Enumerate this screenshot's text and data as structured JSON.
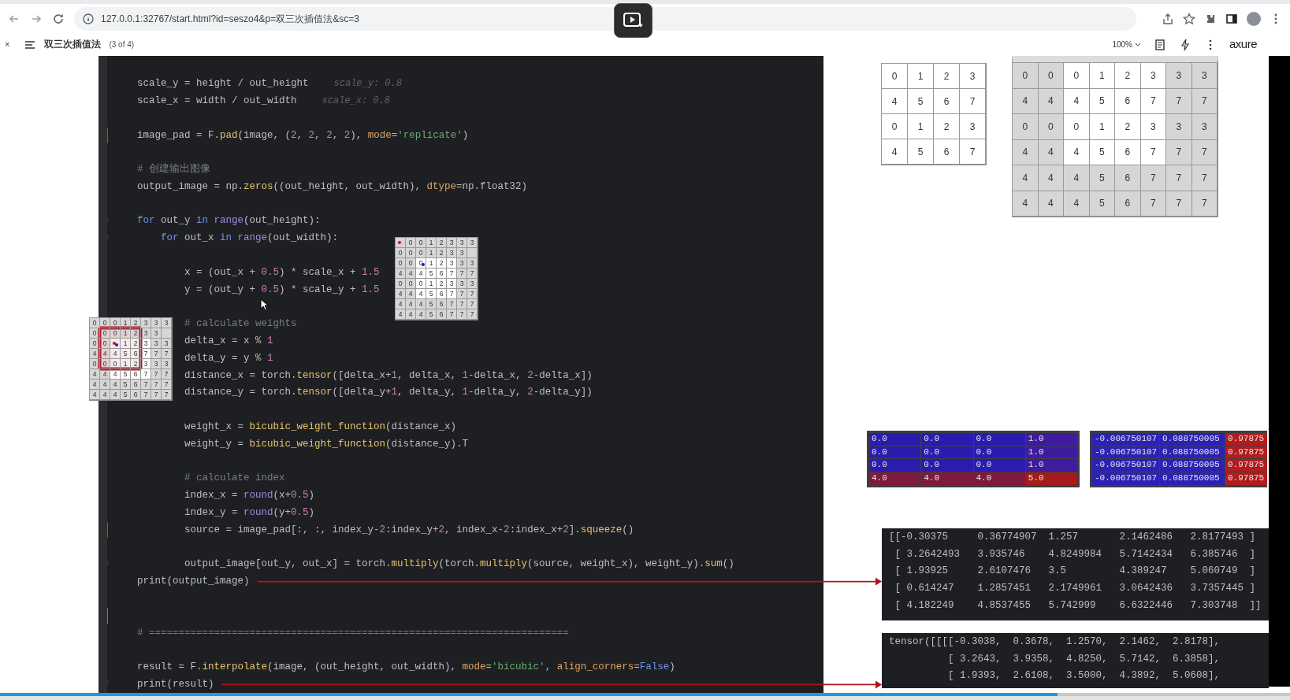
{
  "browser": {
    "url": "127.0.0.1:32767/start.html?id=seszo4&p=双三次插值法&sc=3"
  },
  "player": {
    "close": "×",
    "page_title": "双三次插值法",
    "page_count": "(3 of 4)",
    "zoom": "100%",
    "logo": "axure"
  },
  "code": {
    "lines": [
      {
        "kind": "code",
        "segments": [
          {
            "kind": "plain",
            "text": "scale_y = height / out_height"
          }
        ],
        "hint": "scale_y: 0.8"
      },
      {
        "kind": "code",
        "segments": [
          {
            "kind": "plain",
            "text": "scale_x = width / out_width"
          }
        ],
        "hint": "scale_x: 0.8"
      },
      {
        "kind": "blank"
      },
      {
        "kind": "code",
        "gutter": {
          "kind": "modified"
        },
        "segments": [
          {
            "kind": "plain",
            "text": "image_pad = F."
          },
          {
            "kind": "call",
            "text": "pad"
          },
          {
            "kind": "plain",
            "text": "(image, ("
          },
          {
            "kind": "number",
            "text": "2"
          },
          {
            "kind": "plain",
            "text": ", "
          },
          {
            "kind": "number",
            "text": "2"
          },
          {
            "kind": "plain",
            "text": ", "
          },
          {
            "kind": "number",
            "text": "2"
          },
          {
            "kind": "plain",
            "text": ", "
          },
          {
            "kind": "number",
            "text": "2"
          },
          {
            "kind": "plain",
            "text": "), "
          },
          {
            "kind": "param",
            "text": "mode"
          },
          {
            "kind": "plain",
            "text": "="
          },
          {
            "kind": "string",
            "text": "'replicate'"
          },
          {
            "kind": "plain",
            "text": ")"
          }
        ]
      },
      {
        "kind": "blank"
      },
      {
        "kind": "code",
        "segments": [
          {
            "kind": "comment",
            "text": "# 创建输出图像"
          }
        ]
      },
      {
        "kind": "code",
        "segments": [
          {
            "kind": "plain",
            "text": "output_image = np."
          },
          {
            "kind": "call",
            "text": "zeros"
          },
          {
            "kind": "plain",
            "text": "((out_height, out_width), "
          },
          {
            "kind": "param",
            "text": "dtype"
          },
          {
            "kind": "plain",
            "text": "=np.float32)"
          }
        ]
      },
      {
        "kind": "blank"
      },
      {
        "kind": "code",
        "gutter": {
          "kind": "fold"
        },
        "segments": [
          {
            "kind": "keyword",
            "text": "for"
          },
          {
            "kind": "plain",
            "text": " out_y "
          },
          {
            "kind": "keyword",
            "text": "in"
          },
          {
            "kind": "builtin",
            "text": " range"
          },
          {
            "kind": "plain",
            "text": "(out_height):"
          }
        ],
        "children": [
          {
            "kind": "code",
            "gutter": {
              "kind": "fold"
            },
            "segments": [
              {
                "kind": "keyword",
                "text": "for"
              },
              {
                "kind": "plain",
                "text": " out_x "
              },
              {
                "kind": "keyword",
                "text": "in"
              },
              {
                "kind": "builtin",
                "text": " range"
              },
              {
                "kind": "plain",
                "text": "(out_width):"
              }
            ],
            "children": [
              {
                "kind": "blank"
              },
              {
                "kind": "code",
                "segments": [
                  {
                    "kind": "plain",
                    "text": "x = (out_x + "
                  },
                  {
                    "kind": "number",
                    "text": "0.5"
                  },
                  {
                    "kind": "plain",
                    "text": ") * scale_x + "
                  },
                  {
                    "kind": "number",
                    "text": "1.5"
                  }
                ]
              },
              {
                "kind": "code",
                "segments": [
                  {
                    "kind": "plain",
                    "text": "y = (out_y + "
                  },
                  {
                    "kind": "number",
                    "text": "0.5"
                  },
                  {
                    "kind": "plain",
                    "text": ") * scale_y + "
                  },
                  {
                    "kind": "number",
                    "text": "1.5"
                  }
                ]
              },
              {
                "kind": "blank"
              },
              {
                "kind": "code",
                "segments": [
                  {
                    "kind": "comment",
                    "text": "# calculate weights"
                  }
                ]
              },
              {
                "kind": "code",
                "segments": [
                  {
                    "kind": "plain",
                    "text": "delta_x = x % "
                  },
                  {
                    "kind": "number",
                    "text": "1"
                  }
                ]
              },
              {
                "kind": "code",
                "segments": [
                  {
                    "kind": "plain",
                    "text": "delta_y = y % "
                  },
                  {
                    "kind": "number",
                    "text": "1"
                  }
                ]
              },
              {
                "kind": "code",
                "segments": [
                  {
                    "kind": "plain",
                    "text": "distance_x = torch."
                  },
                  {
                    "kind": "call",
                    "text": "tensor"
                  },
                  {
                    "kind": "plain",
                    "text": "([delta_x+"
                  },
                  {
                    "kind": "number",
                    "text": "1"
                  },
                  {
                    "kind": "plain",
                    "text": ", delta_x, "
                  },
                  {
                    "kind": "number",
                    "text": "1"
                  },
                  {
                    "kind": "plain",
                    "text": "-delta_x, "
                  },
                  {
                    "kind": "number",
                    "text": "2"
                  },
                  {
                    "kind": "plain",
                    "text": "-delta_x])"
                  }
                ]
              },
              {
                "kind": "code",
                "segments": [
                  {
                    "kind": "plain",
                    "text": "distance_y = torch."
                  },
                  {
                    "kind": "call",
                    "text": "tensor"
                  },
                  {
                    "kind": "plain",
                    "text": "([delta_y+"
                  },
                  {
                    "kind": "number",
                    "text": "1"
                  },
                  {
                    "kind": "plain",
                    "text": ", delta_y, "
                  },
                  {
                    "kind": "number",
                    "text": "1"
                  },
                  {
                    "kind": "plain",
                    "text": "-delta_y, "
                  },
                  {
                    "kind": "number",
                    "text": "2"
                  },
                  {
                    "kind": "plain",
                    "text": "-delta_y])"
                  }
                ]
              },
              {
                "kind": "blank"
              },
              {
                "kind": "code",
                "segments": [
                  {
                    "kind": "plain",
                    "text": "weight_x = "
                  },
                  {
                    "kind": "call",
                    "text": "bicubic_weight_function"
                  },
                  {
                    "kind": "plain",
                    "text": "(distance_x)"
                  }
                ]
              },
              {
                "kind": "code",
                "segments": [
                  {
                    "kind": "plain",
                    "text": "weight_y = "
                  },
                  {
                    "kind": "call",
                    "text": "bicubic_weight_function"
                  },
                  {
                    "kind": "plain",
                    "text": "(distance_y).T"
                  }
                ]
              },
              {
                "kind": "blank"
              },
              {
                "kind": "code",
                "segments": [
                  {
                    "kind": "comment",
                    "text": "# calculate index"
                  }
                ]
              },
              {
                "kind": "code",
                "segments": [
                  {
                    "kind": "plain",
                    "text": "index_x = "
                  },
                  {
                    "kind": "builtin",
                    "text": "round"
                  },
                  {
                    "kind": "plain",
                    "text": "(x+"
                  },
                  {
                    "kind": "number",
                    "text": "0.5"
                  },
                  {
                    "kind": "plain",
                    "text": ")"
                  }
                ]
              },
              {
                "kind": "code",
                "segments": [
                  {
                    "kind": "plain",
                    "text": "index_y = "
                  },
                  {
                    "kind": "builtin",
                    "text": "round"
                  },
                  {
                    "kind": "plain",
                    "text": "(y+"
                  },
                  {
                    "kind": "number",
                    "text": "0.5"
                  },
                  {
                    "kind": "plain",
                    "text": ")"
                  }
                ]
              },
              {
                "kind": "code",
                "gutter": {
                  "kind": "modified"
                },
                "segments": [
                  {
                    "kind": "plain",
                    "text": "source = image_pad[:, :, index_y-"
                  },
                  {
                    "kind": "number",
                    "text": "2"
                  },
                  {
                    "kind": "plain",
                    "text": ":index_y+"
                  },
                  {
                    "kind": "number",
                    "text": "2"
                  },
                  {
                    "kind": "plain",
                    "text": ", index_x-"
                  },
                  {
                    "kind": "number",
                    "text": "2"
                  },
                  {
                    "kind": "plain",
                    "text": ":index_x+"
                  },
                  {
                    "kind": "number",
                    "text": "2"
                  },
                  {
                    "kind": "plain",
                    "text": "]."
                  },
                  {
                    "kind": "call",
                    "text": "squeeze"
                  },
                  {
                    "kind": "plain",
                    "text": "()"
                  }
                ]
              },
              {
                "kind": "blank"
              },
              {
                "kind": "code",
                "gutter": {
                  "kind": "fold"
                },
                "segments": [
                  {
                    "kind": "plain",
                    "text": "output_image[out_y, out_x] = torch."
                  },
                  {
                    "kind": "call",
                    "text": "multiply"
                  },
                  {
                    "kind": "plain",
                    "text": "(torch."
                  },
                  {
                    "kind": "call",
                    "text": "multiply"
                  },
                  {
                    "kind": "plain",
                    "text": "(source, weight_x), weight_y)."
                  },
                  {
                    "kind": "call",
                    "text": "sum"
                  },
                  {
                    "kind": "plain",
                    "text": "()"
                  }
                ]
              }
            ]
          }
        ]
      },
      {
        "kind": "code",
        "arrow": true,
        "segments": [
          {
            "kind": "plain",
            "text": "print(output_image)"
          }
        ]
      },
      {
        "kind": "blank"
      },
      {
        "kind": "blank",
        "gutter": {
          "kind": "added"
        }
      },
      {
        "kind": "code",
        "segments": [
          {
            "kind": "comment",
            "text": "# ======================================================================="
          }
        ]
      },
      {
        "kind": "blank"
      },
      {
        "kind": "code",
        "segments": [
          {
            "kind": "plain",
            "text": "result = F."
          },
          {
            "kind": "call",
            "text": "interpolate"
          },
          {
            "kind": "plain",
            "text": "(image, (out_height, out_width), "
          },
          {
            "kind": "param",
            "text": "mode"
          },
          {
            "kind": "plain",
            "text": "="
          },
          {
            "kind": "string",
            "text": "'bicubic'"
          },
          {
            "kind": "plain",
            "text": ", "
          },
          {
            "kind": "param",
            "text": "align_corners"
          },
          {
            "kind": "plain",
            "text": "="
          },
          {
            "kind": "constant",
            "text": "False"
          },
          {
            "kind": "plain",
            "text": ")"
          }
        ]
      },
      {
        "kind": "code",
        "gutter": {
          "kind": "fold"
        },
        "arrow": true,
        "segments": [
          {
            "kind": "plain",
            "text": "print(result)"
          }
        ]
      }
    ]
  },
  "floating_grids": [
    {
      "rows": [
        {
          "cells": [
            {
              "pad": true,
              "dots": [
                {
                  "color": "#c8102e"
                }
              ]
            },
            {
              "t": "0",
              "pad": true
            },
            {
              "t": "0",
              "pad": true
            },
            {
              "t": "1",
              "pad": true
            },
            {
              "t": "2",
              "pad": true
            },
            {
              "t": "3",
              "pad": true
            },
            {
              "t": "3",
              "pad": true
            },
            {
              "t": "3",
              "pad": true
            }
          ]
        },
        {
          "cells": [
            {
              "t": "0",
              "pad": true
            },
            {
              "t": "0",
              "pad": true
            },
            {
              "t": "0",
              "pad": true
            },
            {
              "t": "1",
              "pad": true
            },
            {
              "t": "2",
              "pad": true
            },
            {
              "t": "3",
              "pad": true
            },
            {
              "t": "3",
              "pad": true
            },
            {
              "pad": true
            }
          ]
        },
        {
          "cells": [
            {
              "t": "0",
              "pad": true
            },
            {
              "t": "0",
              "pad": true
            },
            {
              "t": "0",
              "pad": false,
              "dots": [
                {
                  "color": "#1a1ad6"
                }
              ]
            },
            {
              "t": "1",
              "pad": false
            },
            {
              "t": "2",
              "pad": false
            },
            {
              "t": "3",
              "pad": false
            },
            {
              "t": "3",
              "pad": true
            },
            {
              "t": "3",
              "pad": true
            }
          ]
        },
        {
          "cells": [
            {
              "t": "4",
              "pad": true
            },
            {
              "t": "4",
              "pad": true
            },
            {
              "t": "4",
              "pad": false
            },
            {
              "t": "5",
              "pad": false
            },
            {
              "t": "6",
              "pad": false
            },
            {
              "t": "7",
              "pad": false
            },
            {
              "t": "7",
              "pad": true
            },
            {
              "t": "7",
              "pad": true
            }
          ]
        },
        {
          "cells": [
            {
              "t": "0",
              "pad": true
            },
            {
              "t": "0",
              "pad": true
            },
            {
              "t": "0",
              "pad": false
            },
            {
              "t": "1",
              "pad": false
            },
            {
              "t": "2",
              "pad": false
            },
            {
              "t": "3",
              "pad": false
            },
            {
              "t": "3",
              "pad": true
            },
            {
              "t": "3",
              "pad": true
            }
          ]
        },
        {
          "cells": [
            {
              "t": "4",
              "pad": true
            },
            {
              "t": "4",
              "pad": true
            },
            {
              "t": "4",
              "pad": false
            },
            {
              "t": "5",
              "pad": false
            },
            {
              "t": "6",
              "pad": false
            },
            {
              "t": "7",
              "pad": false
            },
            {
              "t": "7",
              "pad": true
            },
            {
              "t": "7",
              "pad": true
            }
          ]
        },
        {
          "cells": [
            {
              "t": "4",
              "pad": true
            },
            {
              "t": "4",
              "pad": true
            },
            {
              "t": "4",
              "pad": true
            },
            {
              "t": "5",
              "pad": true
            },
            {
              "t": "6",
              "pad": true
            },
            {
              "t": "7",
              "pad": true
            },
            {
              "t": "7",
              "pad": true
            },
            {
              "t": "7",
              "pad": true
            }
          ]
        },
        {
          "cells": [
            {
              "t": "4",
              "pad": true
            },
            {
              "t": "4",
              "pad": true
            },
            {
              "t": "4",
              "pad": true
            },
            {
              "t": "5",
              "pad": true
            },
            {
              "t": "6",
              "pad": true
            },
            {
              "t": "7",
              "pad": true
            },
            {
              "t": "7",
              "pad": true
            },
            {
              "t": "7",
              "pad": true
            }
          ]
        }
      ]
    },
    {
      "rows": [
        {
          "cells": [
            {
              "t": "0",
              "pad": true,
              "win": false
            },
            {
              "t": "0",
              "pad": true,
              "win": false
            },
            {
              "t": "0",
              "pad": true,
              "win": false
            },
            {
              "t": "1",
              "pad": true,
              "win": false
            },
            {
              "t": "2",
              "pad": true,
              "win": false
            },
            {
              "t": "3",
              "pad": true,
              "win": false
            },
            {
              "t": "3",
              "pad": true,
              "win": false
            },
            {
              "t": "3",
              "pad": true,
              "win": false
            }
          ]
        },
        {
          "cells": [
            {
              "t": "0",
              "pad": true,
              "win": false
            },
            {
              "t": "0",
              "pad": true,
              "win": true
            },
            {
              "t": "0",
              "pad": true,
              "win": true
            },
            {
              "t": "1",
              "pad": true,
              "win": true
            },
            {
              "t": "2",
              "pad": true,
              "win": true
            },
            {
              "t": "3",
              "pad": true,
              "win": false
            },
            {
              "t": "3",
              "pad": true,
              "win": false
            },
            {
              "pad": true,
              "win": false
            }
          ]
        },
        {
          "cells": [
            {
              "t": "0",
              "pad": true,
              "win": false
            },
            {
              "t": "0",
              "pad": true,
              "win": true
            },
            {
              "pad": false,
              "win": true,
              "dots": [
                {
                  "color": "#c8102e"
                },
                {
                  "color": "#1a1ad6"
                }
              ]
            },
            {
              "t": "1",
              "pad": false,
              "win": true
            },
            {
              "t": "2",
              "pad": false,
              "win": true
            },
            {
              "t": "3",
              "pad": false,
              "win": false
            },
            {
              "t": "3",
              "pad": true,
              "win": false
            },
            {
              "t": "3",
              "pad": true,
              "win": false
            }
          ]
        },
        {
          "cells": [
            {
              "t": "4",
              "pad": true,
              "win": false
            },
            {
              "t": "4",
              "pad": true,
              "win": true
            },
            {
              "t": "4",
              "pad": false,
              "win": true
            },
            {
              "t": "5",
              "pad": false,
              "win": true
            },
            {
              "t": "6",
              "pad": false,
              "win": true
            },
            {
              "t": "7",
              "pad": false,
              "win": false
            },
            {
              "t": "7",
              "pad": true,
              "win": false
            },
            {
              "t": "7",
              "pad": true,
              "win": false
            }
          ]
        },
        {
          "cells": [
            {
              "t": "0",
              "pad": true,
              "win": false
            },
            {
              "t": "0",
              "pad": true,
              "win": true
            },
            {
              "t": "0",
              "pad": false,
              "win": true
            },
            {
              "t": "1",
              "pad": false,
              "win": true
            },
            {
              "t": "2",
              "pad": false,
              "win": true
            },
            {
              "t": "3",
              "pad": false,
              "win": false
            },
            {
              "t": "3",
              "pad": true,
              "win": false
            },
            {
              "t": "3",
              "pad": true,
              "win": false
            }
          ]
        },
        {
          "cells": [
            {
              "t": "4",
              "pad": true,
              "win": false
            },
            {
              "t": "4",
              "pad": true,
              "win": false
            },
            {
              "t": "4",
              "pad": false,
              "win": false
            },
            {
              "t": "5",
              "pad": false,
              "win": false
            },
            {
              "t": "6",
              "pad": false,
              "win": false
            },
            {
              "t": "7",
              "pad": false,
              "win": false
            },
            {
              "t": "7",
              "pad": true,
              "win": false
            },
            {
              "t": "7",
              "pad": true,
              "win": false
            }
          ]
        },
        {
          "cells": [
            {
              "t": "4",
              "pad": true,
              "win": false
            },
            {
              "t": "4",
              "pad": true,
              "win": false
            },
            {
              "t": "4",
              "pad": true,
              "win": false
            },
            {
              "t": "5",
              "pad": true,
              "win": false
            },
            {
              "t": "6",
              "pad": true,
              "win": false
            },
            {
              "t": "7",
              "pad": true,
              "win": false
            },
            {
              "t": "7",
              "pad": true,
              "win": false
            },
            {
              "t": "7",
              "pad": true,
              "win": false
            }
          ]
        },
        {
          "cells": [
            {
              "t": "4",
              "pad": true,
              "win": false
            },
            {
              "t": "4",
              "pad": true,
              "win": false
            },
            {
              "t": "4",
              "pad": true,
              "win": false
            },
            {
              "t": "5",
              "pad": true,
              "win": false
            },
            {
              "t": "6",
              "pad": true,
              "win": false
            },
            {
              "t": "7",
              "pad": true,
              "win": false
            },
            {
              "t": "7",
              "pad": true,
              "win": false
            },
            {
              "t": "7",
              "pad": true,
              "win": false
            }
          ]
        }
      ]
    }
  ],
  "source_grid": {
    "rows": [
      {
        "cells": [
          {
            "t": "0"
          },
          {
            "t": "1"
          },
          {
            "t": "2"
          },
          {
            "t": "3"
          }
        ]
      },
      {
        "cells": [
          {
            "t": "4"
          },
          {
            "t": "5"
          },
          {
            "t": "6"
          },
          {
            "t": "7"
          }
        ]
      },
      {
        "cells": [
          {
            "t": "0"
          },
          {
            "t": "1"
          },
          {
            "t": "2"
          },
          {
            "t": "3"
          }
        ]
      },
      {
        "cells": [
          {
            "t": "4"
          },
          {
            "t": "5"
          },
          {
            "t": "6"
          },
          {
            "t": "7"
          }
        ]
      }
    ]
  },
  "padded_grid": {
    "rows": [
      {
        "cells": [
          {
            "t": "0",
            "pad": true
          },
          {
            "t": "0",
            "pad": true
          },
          {
            "t": "0",
            "pad": false
          },
          {
            "t": "1",
            "pad": false
          },
          {
            "t": "2",
            "pad": false
          },
          {
            "t": "3",
            "pad": false
          },
          {
            "t": "3",
            "pad": true
          },
          {
            "t": "3",
            "pad": true
          }
        ]
      },
      {
        "cells": [
          {
            "t": "4",
            "pad": true
          },
          {
            "t": "4",
            "pad": true
          },
          {
            "t": "4",
            "pad": false
          },
          {
            "t": "5",
            "pad": false
          },
          {
            "t": "6",
            "pad": false
          },
          {
            "t": "7",
            "pad": false
          },
          {
            "t": "7",
            "pad": true
          },
          {
            "t": "7",
            "pad": true
          }
        ]
      },
      {
        "cells": [
          {
            "t": "0",
            "pad": true
          },
          {
            "t": "0",
            "pad": true
          },
          {
            "t": "0",
            "pad": false
          },
          {
            "t": "1",
            "pad": false
          },
          {
            "t": "2",
            "pad": false
          },
          {
            "t": "3",
            "pad": false
          },
          {
            "t": "3",
            "pad": true
          },
          {
            "t": "3",
            "pad": true
          }
        ]
      },
      {
        "cells": [
          {
            "t": "4",
            "pad": true
          },
          {
            "t": "4",
            "pad": true
          },
          {
            "t": "4",
            "pad": false
          },
          {
            "t": "5",
            "pad": false
          },
          {
            "t": "6",
            "pad": false
          },
          {
            "t": "7",
            "pad": false
          },
          {
            "t": "7",
            "pad": true
          },
          {
            "t": "7",
            "pad": true
          }
        ]
      },
      {
        "cells": [
          {
            "t": "4",
            "pad": true
          },
          {
            "t": "4",
            "pad": true
          },
          {
            "t": "4",
            "pad": true
          },
          {
            "t": "5",
            "pad": true
          },
          {
            "t": "6",
            "pad": true
          },
          {
            "t": "7",
            "pad": true
          },
          {
            "t": "7",
            "pad": true
          },
          {
            "t": "7",
            "pad": true
          }
        ]
      },
      {
        "cells": [
          {
            "t": "4",
            "pad": true
          },
          {
            "t": "4",
            "pad": true
          },
          {
            "t": "4",
            "pad": true
          },
          {
            "t": "5",
            "pad": true
          },
          {
            "t": "6",
            "pad": true
          },
          {
            "t": "7",
            "pad": true
          },
          {
            "t": "7",
            "pad": true
          },
          {
            "t": "7",
            "pad": true
          }
        ]
      }
    ]
  },
  "color_tables": [
    {
      "rows": [
        {
          "cells": [
            {
              "t": "0.0",
              "color": "#2b1cb0"
            },
            {
              "t": "0.0",
              "color": "#2b1cb0"
            },
            {
              "t": "0.0",
              "color": "#2b1cb0"
            },
            {
              "t": "1.0",
              "color": "#3f1c9e"
            }
          ]
        },
        {
          "cells": [
            {
              "t": "0.0",
              "color": "#2b1cb0"
            },
            {
              "t": "0.0",
              "color": "#2b1cb0"
            },
            {
              "t": "0.0",
              "color": "#2b1cb0"
            },
            {
              "t": "1.0",
              "color": "#3f1c9e"
            }
          ]
        },
        {
          "cells": [
            {
              "t": "0.0",
              "color": "#2b1cb0"
            },
            {
              "t": "0.0",
              "color": "#2b1cb0"
            },
            {
              "t": "0.0",
              "color": "#2b1cb0"
            },
            {
              "t": "1.0",
              "color": "#3f1c9e"
            }
          ]
        },
        {
          "cells": [
            {
              "t": "4.0",
              "color": "#7d1a3e"
            },
            {
              "t": "4.0",
              "color": "#7d1a3e"
            },
            {
              "t": "4.0",
              "color": "#7d1a3e"
            },
            {
              "t": "5.0",
              "color": "#a61b1b"
            }
          ]
        }
      ]
    },
    {
      "rows": [
        {
          "cells": [
            {
              "t": "-0.006750107",
              "color": "#2b22b5"
            },
            {
              "t": "0.088750005",
              "color": "#2b22b5"
            },
            {
              "t": "0.97875",
              "color": "#b21c1c"
            }
          ]
        },
        {
          "cells": [
            {
              "t": "-0.006750107",
              "color": "#2b22b5"
            },
            {
              "t": "0.088750005",
              "color": "#2b22b5"
            },
            {
              "t": "0.97875",
              "color": "#b21c1c"
            }
          ]
        },
        {
          "cells": [
            {
              "t": "-0.006750107",
              "color": "#2b22b5"
            },
            {
              "t": "0.088750005",
              "color": "#2b22b5"
            },
            {
              "t": "0.97875",
              "color": "#b21c1c"
            }
          ]
        },
        {
          "cells": [
            {
              "t": "-0.006750107",
              "color": "#2b22b5"
            },
            {
              "t": "0.088750005",
              "color": "#2b22b5"
            },
            {
              "t": "0.97875",
              "color": "#b21c1c"
            }
          ]
        }
      ]
    }
  ],
  "matrix_output": {
    "lines": [
      "[[-0.30375     0.36774907  1.257       2.1462486   2.8177493 ]",
      " [ 3.2642493   3.935746    4.8249984   5.7142434   6.385746  ]",
      " [ 1.93925     2.6107476   3.5         4.389247    5.060749  ]",
      " [ 0.614247    1.2857451   2.1749961   3.0642436   3.7357445 ]",
      " [ 4.182249    4.8537455   5.742999    6.6322446   7.303748  ]]"
    ]
  },
  "tensor_output": {
    "lines": [
      "tensor([[[[-0.3038,  0.3678,  1.2570,  2.1462,  2.8178],",
      "          [ 3.2643,  3.9358,  4.8250,  5.7142,  6.3858],",
      "          [ 1.9393,  2.6108,  3.5000,  4.3892,  5.0608],"
    ]
  },
  "video_progress": {
    "level": 0.82
  }
}
